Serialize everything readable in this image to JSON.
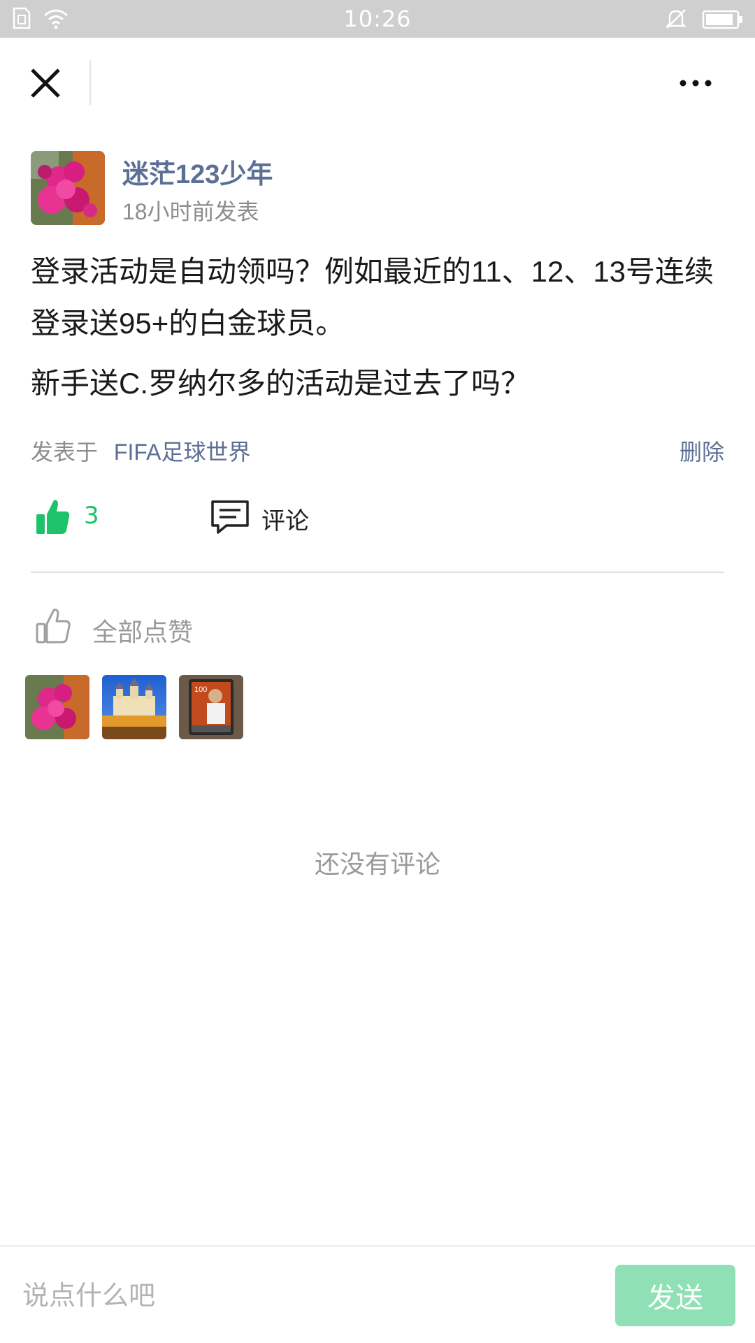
{
  "status_bar": {
    "time": "10:26",
    "icons": [
      "sim-icon",
      "wifi-icon",
      "bell-muted-icon",
      "battery-icon"
    ]
  },
  "top_bar": {
    "close_icon": "close-icon",
    "more_icon": "more-icon"
  },
  "post": {
    "author": "迷茫123少年",
    "time": "18小时前发表",
    "paragraphs": [
      "登录活动是自动领吗？例如最近的11、12、13号连续登录送95+的白金球员。",
      "新手送C.罗纳尔多的活动是过去了吗？"
    ],
    "posted_in_label": "发表于",
    "forum": "FIFA足球世界",
    "delete_label": "删除"
  },
  "actions": {
    "like_count": "3",
    "comment_label": "评论"
  },
  "likes": {
    "header": "全部点赞",
    "avatars": [
      "flower-avatar",
      "castle-avatar",
      "player-card-avatar"
    ],
    "card_rating": "100"
  },
  "comments": {
    "empty_text": "还没有评论"
  },
  "composer": {
    "placeholder": "说点什么吧",
    "send_label": "发送"
  },
  "colors": {
    "accent_green": "#1ec26a",
    "link_blue": "#5d6f95",
    "send_button": "#8fe0b4",
    "status_bar": "#cfcfcf"
  }
}
